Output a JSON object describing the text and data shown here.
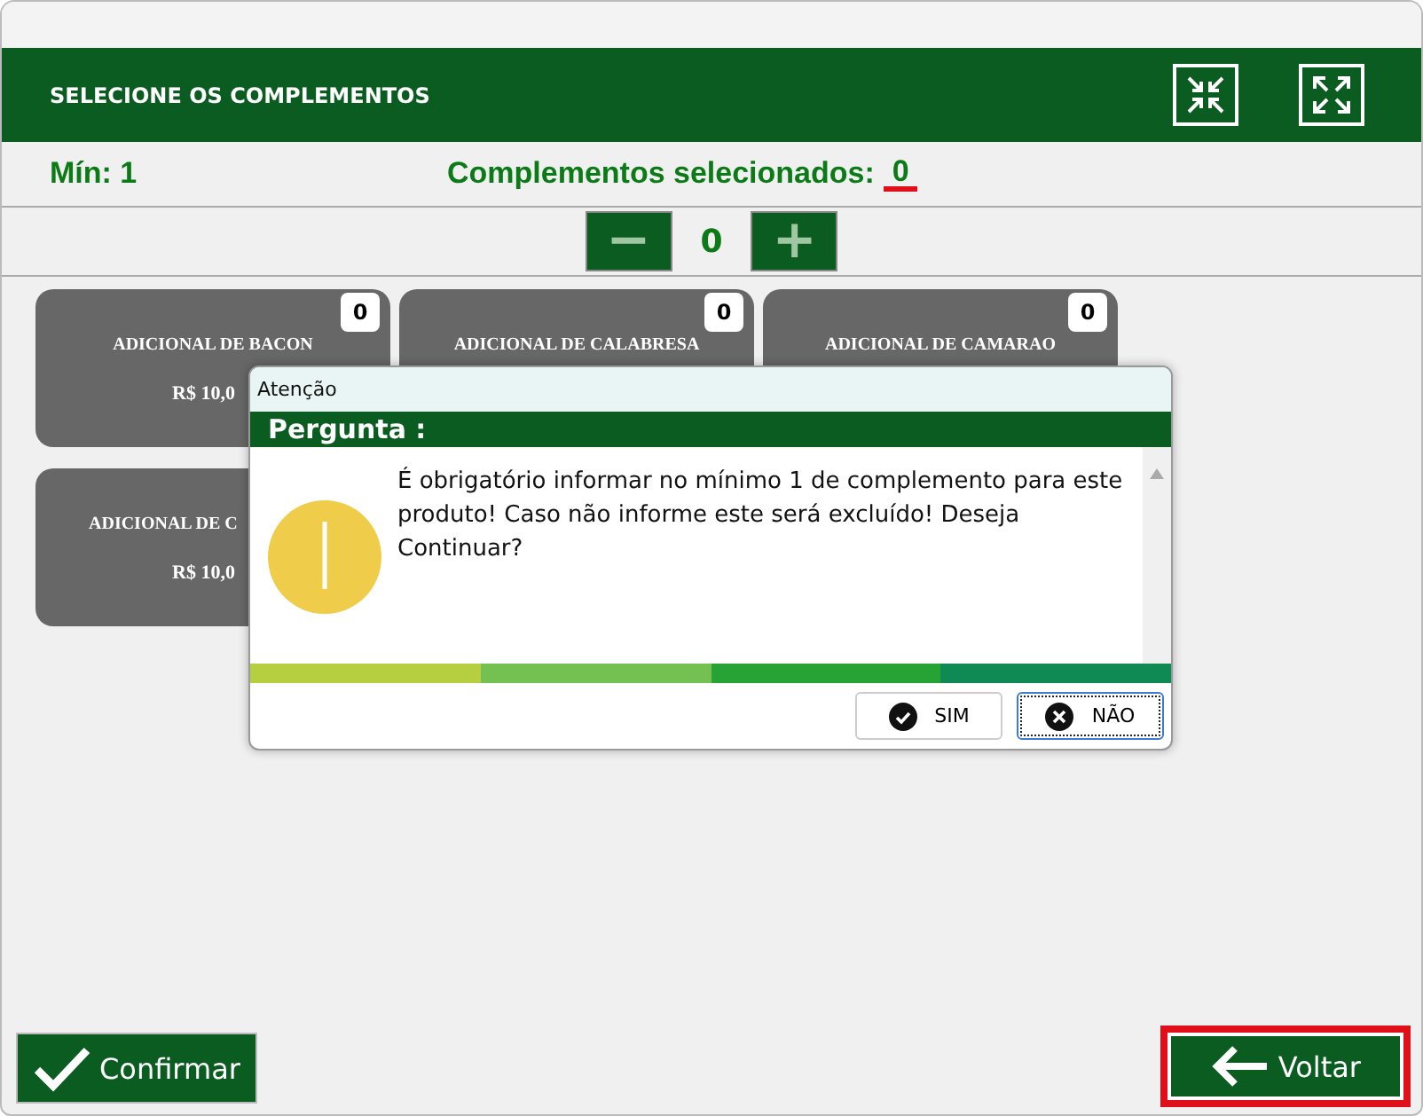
{
  "header": {
    "title": "SELECIONE OS COMPLEMENTOS"
  },
  "info": {
    "min_label": "Mín: 1",
    "selected_label": "Complementos selecionados:",
    "selected_count": "0"
  },
  "quantity": {
    "minus": "−",
    "value": "0",
    "plus": "+"
  },
  "cards": [
    {
      "name": "ADICIONAL DE BACON",
      "price": "R$ 10,0",
      "badge": "0"
    },
    {
      "name": "ADICIONAL DE CALABRESA",
      "badge": "0"
    },
    {
      "name": "ADICIONAL DE CAMARAO",
      "badge": "0"
    },
    {
      "name": "ADICIONAL DE C",
      "price": "R$ 10,0"
    }
  ],
  "dialog": {
    "title": "Atenção",
    "heading": "Pergunta :",
    "message": "É obrigatório informar no mínimo 1 de complemento para este produto! Caso não informe este será excluído! Deseja Continuar?",
    "stripe": [
      {
        "color": "#b5cf40"
      },
      {
        "color": "#74c152"
      },
      {
        "color": "#27a235"
      },
      {
        "color": "#0f8a55"
      }
    ],
    "buttons": [
      {
        "label": "SIM",
        "kind": "yes",
        "focused": false
      },
      {
        "label": "NÃO",
        "kind": "no",
        "focused": true
      }
    ]
  },
  "footer": {
    "confirm": "Confirmar",
    "back": "Voltar",
    "back_highlighted": true
  }
}
